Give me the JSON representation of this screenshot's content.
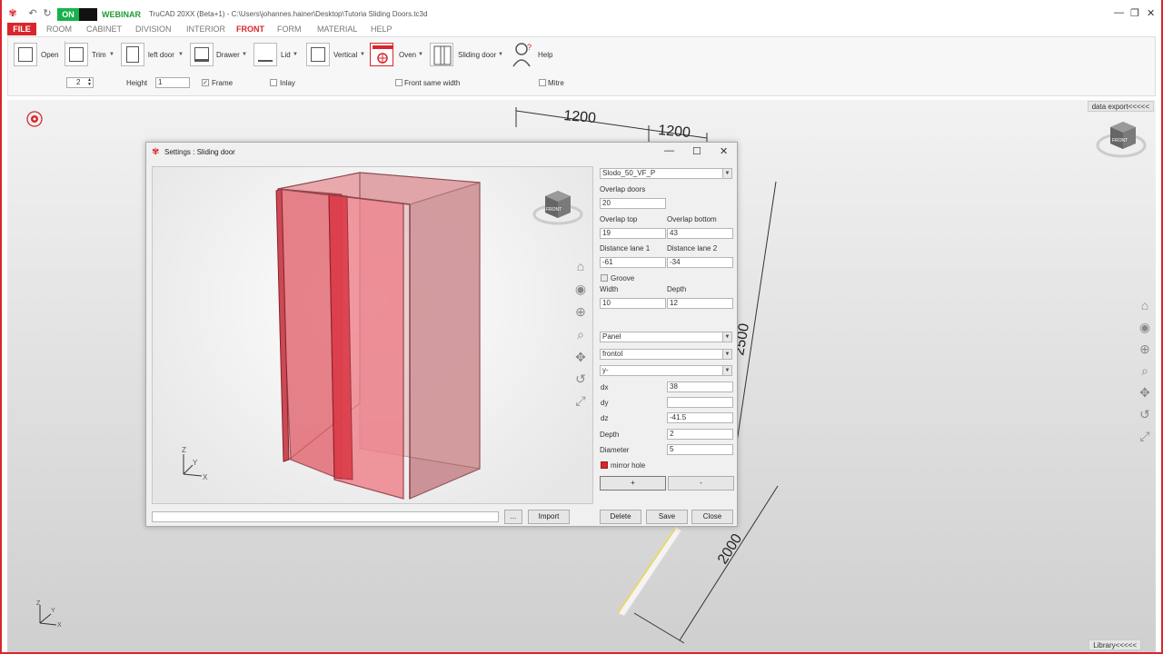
{
  "app": {
    "on_label": "ON",
    "webinar_label": "WEBINAR",
    "title": "TruCAD 20XX (Beta+1) - C:\\Users\\johannes.hainer\\Desktop\\Tutoria Sliding Doors.tc3d",
    "accent": "#d8262c",
    "on_color": "#17b24a"
  },
  "menu": {
    "file": "FILE",
    "room": "ROOM",
    "cabinet": "CABINET",
    "division": "DIVISION",
    "interior": "INTERIOR",
    "front": "FRONT",
    "form": "FORM",
    "material": "MATERIAL",
    "help": "HELP"
  },
  "ribbon": {
    "open": "Open",
    "trim": "Trim",
    "left_door": "left door",
    "drawer": "Drawer",
    "lid": "Lid",
    "vertical": "Vertical",
    "oven": "Oven",
    "sliding_door": "Sliding door",
    "help": "Help",
    "count_value": "2",
    "height_label": "Height",
    "height_value": "1",
    "frame_label": "Frame",
    "inlay_label": "Inlay",
    "front_same_width_label": "Front same width",
    "mitre_label": "Mitre"
  },
  "workspace": {
    "data_export": "data export<<<<<",
    "library": "Library<<<<<",
    "dim_1200_a": "1200",
    "dim_1200_b": "1200",
    "dim_2500": "2500",
    "dim_2000": "2000"
  },
  "dialog": {
    "title": "Settings : Sliding door",
    "profile": "Slodo_50_VF_P",
    "overlap_doors_label": "Overlap doors",
    "overlap_doors": "20",
    "overlap_top_label": "Overlap top",
    "overlap_top": "19",
    "overlap_bottom_label": "Overlap bottom",
    "overlap_bottom": "43",
    "distance_lane1_label": "Distance lane 1",
    "distance_lane1": "-61",
    "distance_lane2_label": "Distance lane 2",
    "distance_lane2": "-34",
    "groove_label": "Groove",
    "width_label": "Width",
    "width": "10",
    "depth_label": "Depth",
    "depth": "12",
    "panel": "Panel",
    "frontol": "frontol",
    "axis": "y-",
    "dx_label": "dx",
    "dx": "38",
    "dy_label": "dy",
    "dy": "",
    "dz_label": "dz",
    "dz": "-41.5",
    "hole_depth_label": "Depth",
    "hole_depth": "2",
    "diameter_label": "Diameter",
    "diameter": "5",
    "mirror_hole_label": "mirror hole",
    "plus": "+",
    "minus": "-",
    "browse": "...",
    "import": "Import",
    "delete": "Delete",
    "save": "Save",
    "close": "Close",
    "cube_front": "FRONT",
    "axis_z": "Z",
    "axis_y": "Y",
    "axis_x": "X"
  }
}
